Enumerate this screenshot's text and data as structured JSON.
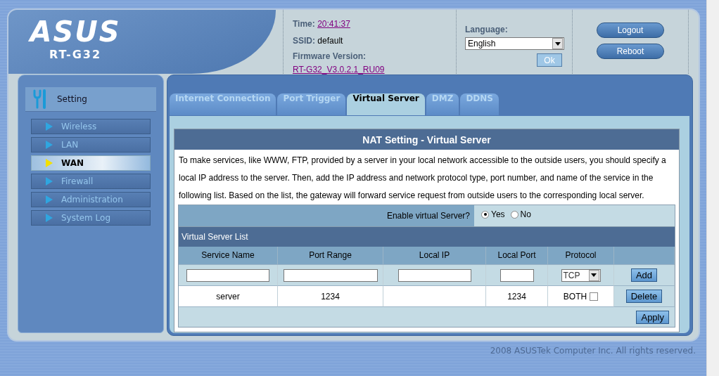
{
  "header": {
    "logo": "ASUS",
    "model": "RT-G32",
    "time_label": "Time:",
    "time": "20:41:37",
    "ssid_label": "SSID:",
    "ssid": "default",
    "firmware_label": "Firmware Version:",
    "firmware": "RT-G32_V3.0.2.1_RU09",
    "language_label": "Language:",
    "language": "English",
    "ok_button": "Ok",
    "buttons": [
      "Logout",
      "Reboot"
    ]
  },
  "sidebar": {
    "title": "Setting",
    "items": [
      {
        "label": "Wireless",
        "selected": false
      },
      {
        "label": "LAN",
        "selected": false
      },
      {
        "label": "WAN",
        "selected": true
      },
      {
        "label": "Firewall",
        "selected": false
      },
      {
        "label": "Administration",
        "selected": false
      },
      {
        "label": "System Log",
        "selected": false
      }
    ]
  },
  "tabs": [
    {
      "label": "Internet Connection",
      "selected": false
    },
    {
      "label": "Port Trigger",
      "selected": false
    },
    {
      "label": "Virtual Server",
      "selected": true
    },
    {
      "label": "DMZ",
      "selected": false
    },
    {
      "label": "DDNS",
      "selected": false
    }
  ],
  "panel": {
    "title": "NAT Setting - Virtual Server",
    "description": "To make services, like WWW, FTP, provided by a server in your local network accessible to the outside users, you should specify a local IP address to the server. Then, add the IP address and network protocol type, port number, and name of the service in the following list. Based on the list, the gateway will forward service request from outside users to the corresponding local server.",
    "enable_label": "Enable virtual Server?",
    "enable_options": [
      {
        "label": "Yes",
        "selected": true
      },
      {
        "label": "No",
        "selected": false
      }
    ],
    "list_title": "Virtual Server List",
    "columns": [
      "Service Name",
      "Port Range",
      "Local IP",
      "Local Port",
      "Protocol"
    ],
    "protocol": "TCP",
    "add_button": "Add",
    "rows": [
      {
        "service_name": "server",
        "port_range": "1234",
        "local_port": "1234",
        "protocol": "BOTH",
        "checked": false
      }
    ],
    "delete_button": "Delete",
    "apply_button": "Apply"
  },
  "footer": "2008 ASUSTek Computer Inc. All rights reserved."
}
